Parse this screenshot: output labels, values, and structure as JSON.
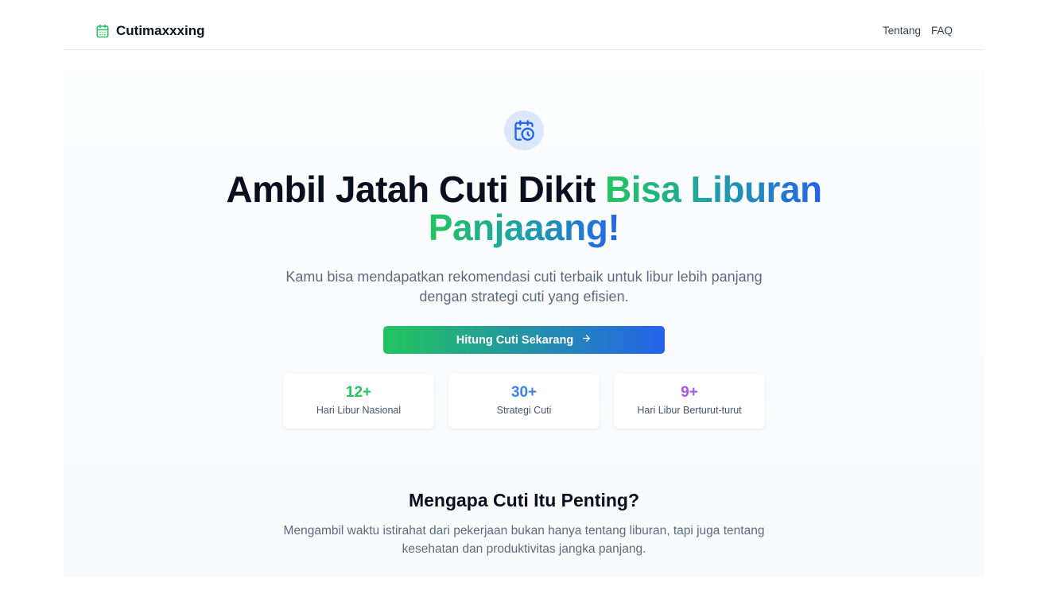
{
  "header": {
    "brand": "Cutimaxxxing",
    "brand_icon": "calendar-icon",
    "nav": [
      "Tentang",
      "FAQ"
    ]
  },
  "hero": {
    "icon": "calendar-clock-icon",
    "headline_plain": "Ambil Jatah Cuti Dikit ",
    "headline_highlight_1": "Bisa Liburan",
    "headline_highlight_2": "Panjaaang!",
    "subtitle": "Kamu bisa mendapatkan rekomendasi cuti terbaik untuk libur lebih panjang dengan strategi cuti yang efisien.",
    "cta_label": "Hitung Cuti Sekarang",
    "cta_icon": "arrow-right-icon"
  },
  "stats": [
    {
      "value": "12+",
      "label": "Hari Libur Nasional",
      "color": "#22c55e"
    },
    {
      "value": "30+",
      "label": "Strategi Cuti",
      "color": "#3b82f6"
    },
    {
      "value": "9+",
      "label": "Hari Libur Berturut-turut",
      "color": "#a855f7"
    }
  ],
  "why": {
    "title": "Mengapa Cuti Itu Penting?",
    "description": "Mengambil waktu istirahat dari pekerjaan bukan hanya tentang liburan, tapi juga tentang kesehatan dan produktivitas jangka panjang."
  },
  "colors": {
    "accent_green": "#22c55e",
    "accent_blue": "#2563eb",
    "text_muted": "#5b6b82"
  }
}
